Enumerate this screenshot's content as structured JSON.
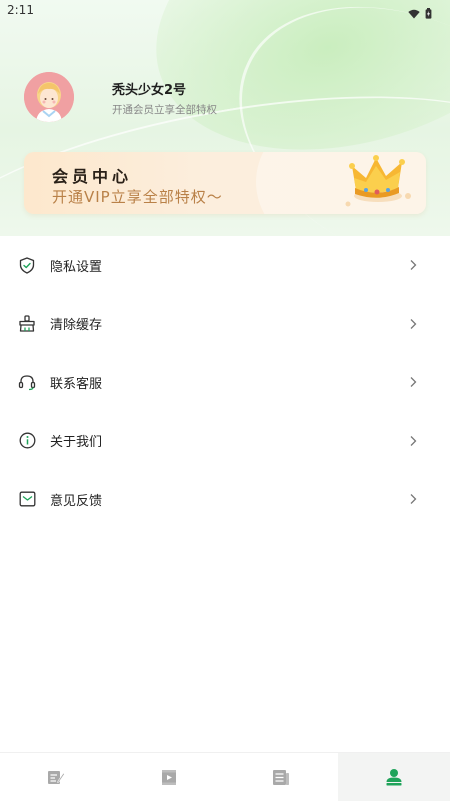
{
  "status_bar": {
    "time": "2:11",
    "icons": [
      "wifi-icon",
      "battery-icon"
    ]
  },
  "profile": {
    "username": "秃头少女2号",
    "subtitle": "开通会员立享全部特权",
    "avatar_icon": "girl-avatar-icon"
  },
  "vip_banner": {
    "title": "会员中心",
    "subtitle": "开通VIP立享全部特权～",
    "icon": "crown-icon"
  },
  "menu": {
    "items": [
      {
        "label": "隐私设置",
        "icon": "shield-check-icon"
      },
      {
        "label": "清除缓存",
        "icon": "broom-icon"
      },
      {
        "label": "联系客服",
        "icon": "headset-icon"
      },
      {
        "label": "关于我们",
        "icon": "info-icon"
      },
      {
        "label": "意见反馈",
        "icon": "feedback-icon"
      }
    ]
  },
  "bottom_nav": {
    "tabs": [
      {
        "icon": "edit-note-icon",
        "active": false
      },
      {
        "icon": "video-icon",
        "active": false
      },
      {
        "icon": "document-icon",
        "active": false
      },
      {
        "icon": "profile-icon",
        "active": true
      }
    ]
  },
  "colors": {
    "accent_green": "#1fa35a",
    "vip_gold": "#b98148",
    "avatar_bg": "#f0a0a2"
  }
}
